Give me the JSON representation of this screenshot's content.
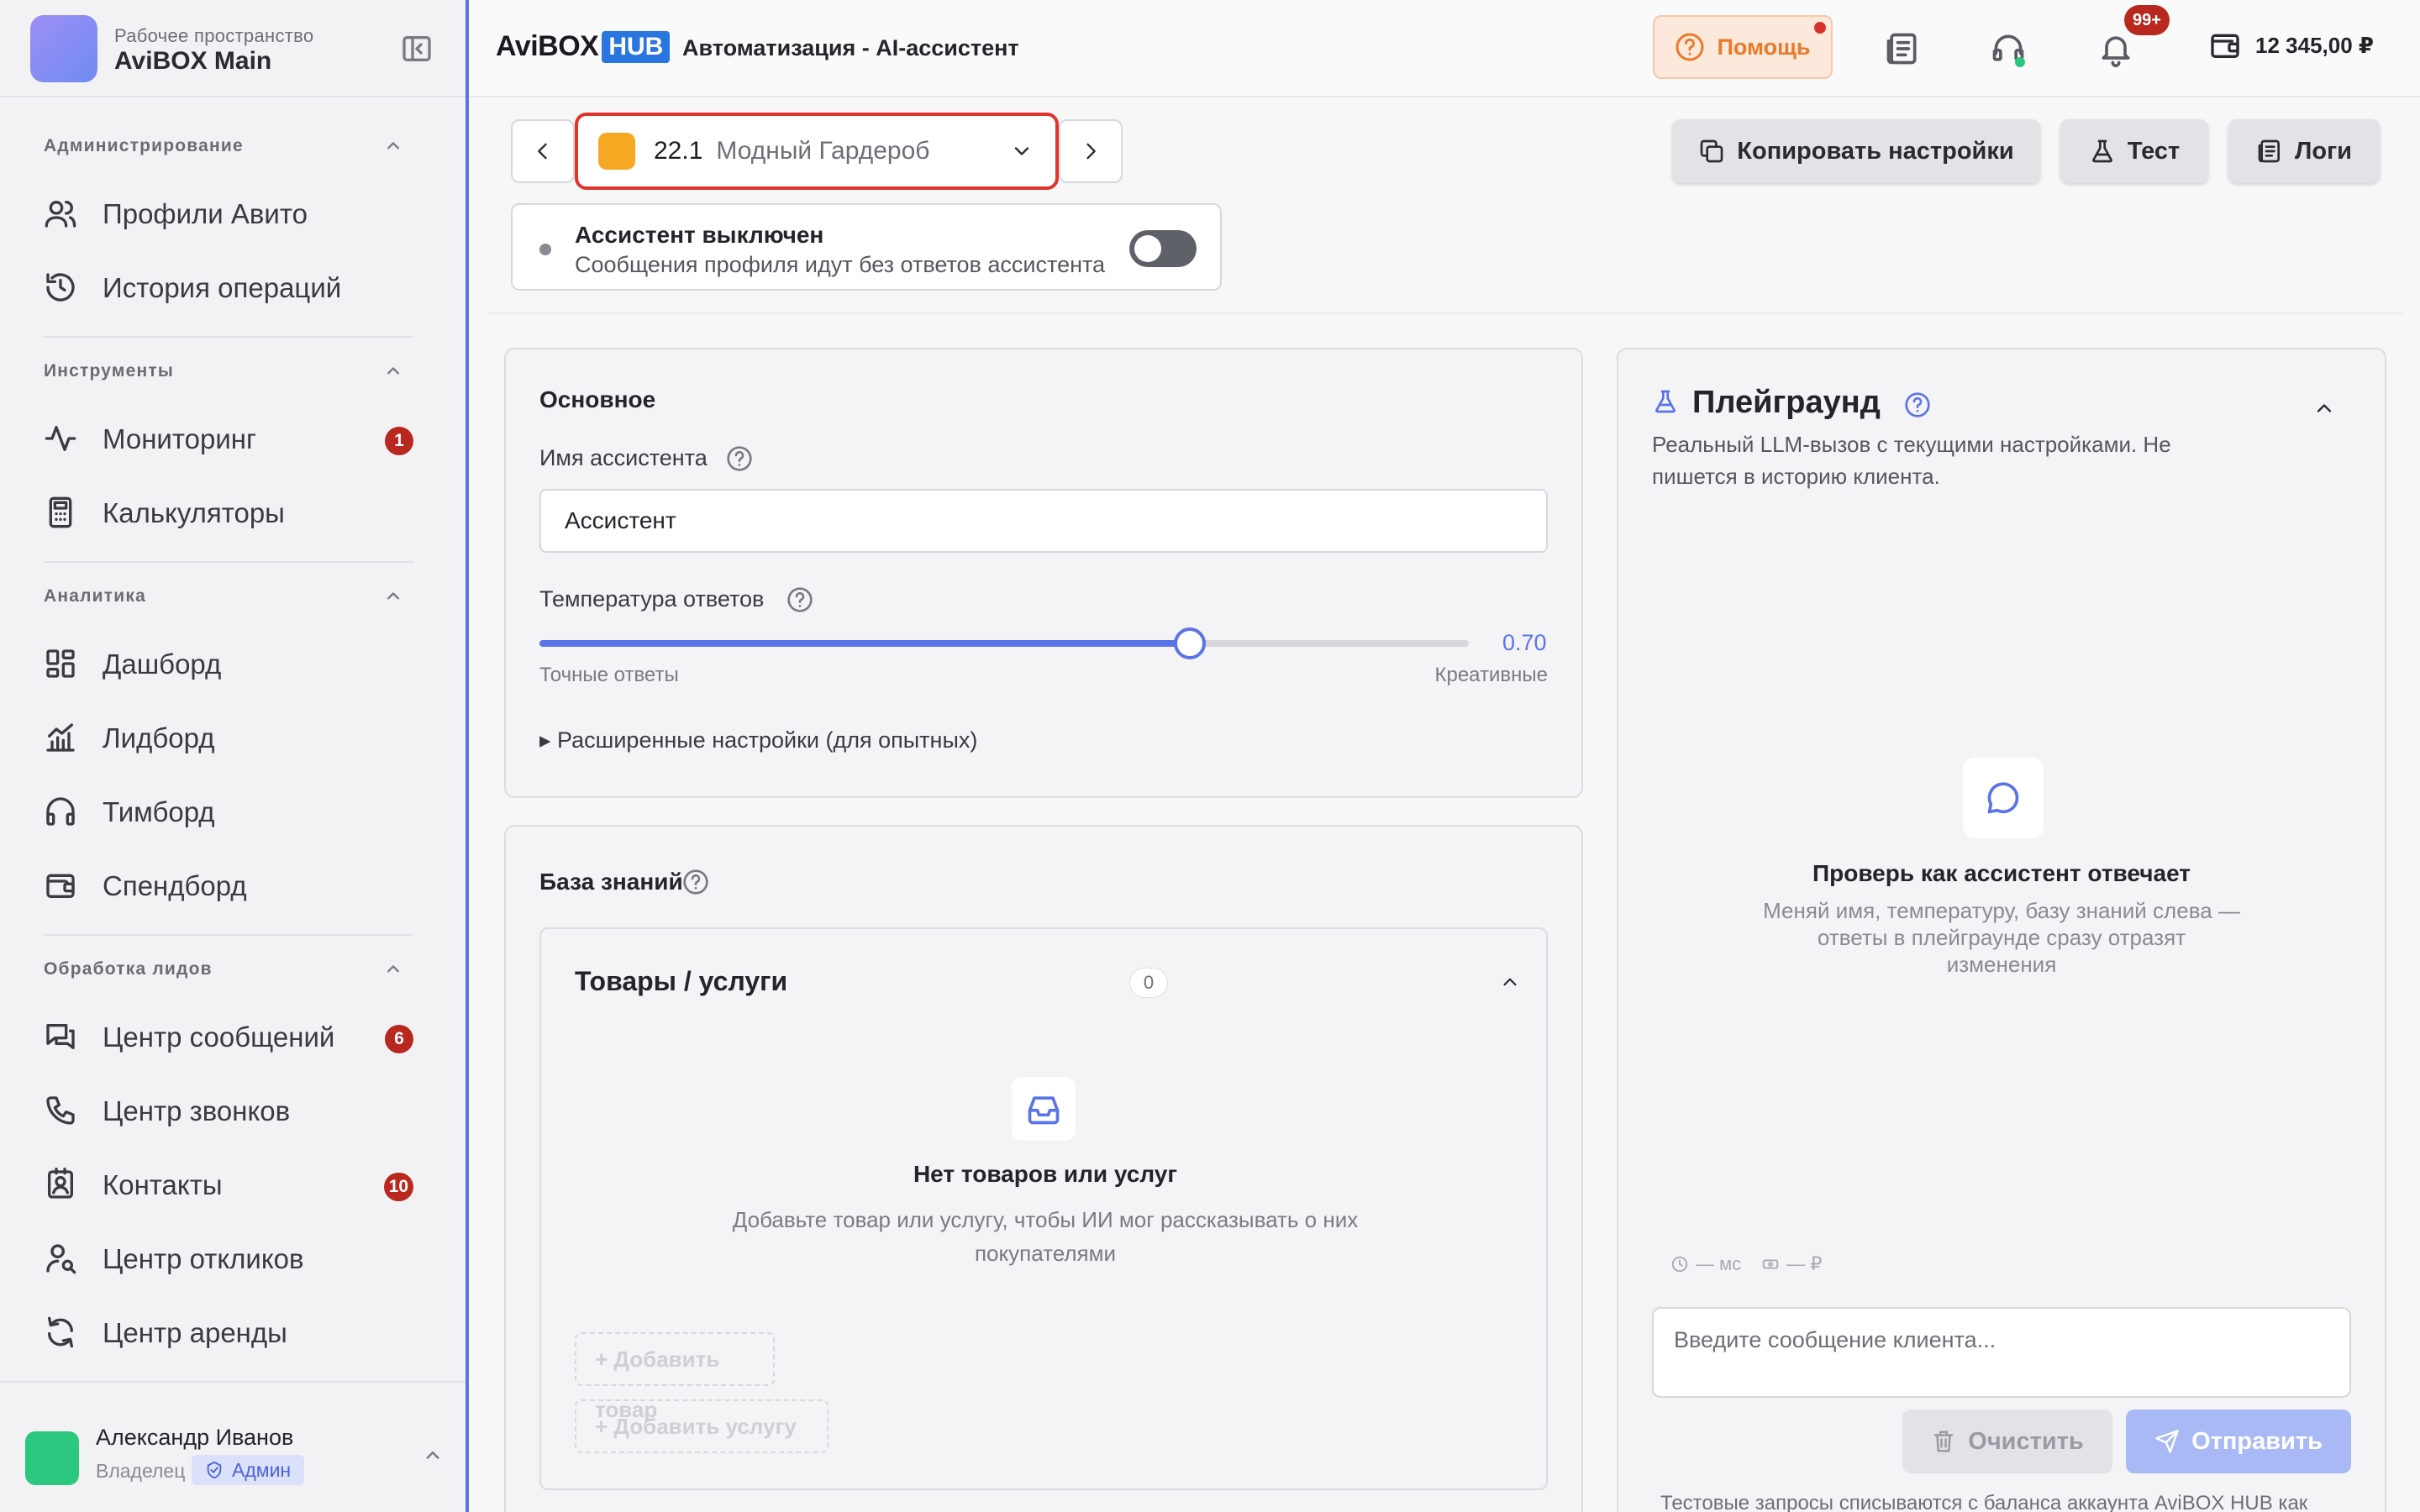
{
  "workspace": {
    "subtitle": "Рабочее пространство",
    "name": "AviBOX Main"
  },
  "sidebar": {
    "sections": [
      {
        "title": "Администрирование",
        "items": [
          {
            "label": "Профили Авито",
            "icon": "users-icon"
          },
          {
            "label": "История операций",
            "icon": "history-icon"
          }
        ]
      },
      {
        "title": "Инструменты",
        "items": [
          {
            "label": "Мониторинг",
            "icon": "activity-icon",
            "badge": "1"
          },
          {
            "label": "Калькуляторы",
            "icon": "calculator-icon"
          }
        ]
      },
      {
        "title": "Аналитика",
        "items": [
          {
            "label": "Дашборд",
            "icon": "dashboard-icon"
          },
          {
            "label": "Лидборд",
            "icon": "bar-chart-icon"
          },
          {
            "label": "Тимборд",
            "icon": "headphones-icon"
          },
          {
            "label": "Спендборд",
            "icon": "wallet-icon"
          }
        ]
      },
      {
        "title": "Обработка лидов",
        "items": [
          {
            "label": "Центр сообщений",
            "icon": "messages-icon",
            "badge": "6"
          },
          {
            "label": "Центр звонков",
            "icon": "phone-icon"
          },
          {
            "label": "Контакты",
            "icon": "contacts-icon",
            "badge": "10"
          },
          {
            "label": "Центр откликов",
            "icon": "user-search-icon"
          },
          {
            "label": "Центр аренды",
            "icon": "refresh-icon"
          }
        ]
      }
    ]
  },
  "user": {
    "name": "Александр Иванов",
    "role": "Владелец",
    "badge": "Админ"
  },
  "header": {
    "logo_text": "AviBOX",
    "logo_badge": "HUB",
    "breadcrumb": "Автоматизация - AI-ассистент",
    "help_label": "Помощь",
    "notifications_badge": "99+",
    "balance": "12 345,00 ₽"
  },
  "toolbar": {
    "profile_number": "22.1",
    "profile_name": "Модный Гардероб",
    "profile_color": "#f7a823",
    "copy_label": "Копировать настройки",
    "test_label": "Тест",
    "logs_label": "Логи"
  },
  "status": {
    "title": "Ассистент выключен",
    "subtitle": "Сообщения профиля идут без ответов ассистента",
    "enabled": false
  },
  "main_card": {
    "title": "Основное",
    "name_label": "Имя ассистента",
    "name_value": "Ассистент",
    "temp_label": "Температура ответов",
    "temp_value": 0.7,
    "temp_display": "0.70",
    "temp_min_label": "Точные ответы",
    "temp_max_label": "Креативные",
    "advanced_label": "▸ Расширенные настройки (для опытных)"
  },
  "knowledge": {
    "title": "База знаний",
    "section_title": "Товары / услуги",
    "count": "0",
    "empty_title": "Нет товаров или услуг",
    "empty_sub": "Добавьте товар или услугу, чтобы ИИ мог рассказывать о них покупателями",
    "add_product": "+ Добавить товар",
    "add_service": "+ Добавить услугу"
  },
  "playground": {
    "title": "Плейграунд",
    "subtitle": "Реальный LLM-вызов с текущими настройками. Не пишется в историю клиента.",
    "empty_title": "Проверь как ассистент отвечает",
    "empty_sub": "Меняй имя, температуру, базу знаний слева — ответы в плейграунде сразу отразят изменения",
    "metric_time": "— мс",
    "metric_cost": "— ₽",
    "input_placeholder": "Введите сообщение клиента...",
    "clear_label": "Очистить",
    "send_label": "Отправить",
    "footer_note": "Тестовые запросы списываются с баланса аккаунта AviBOX HUB как"
  }
}
